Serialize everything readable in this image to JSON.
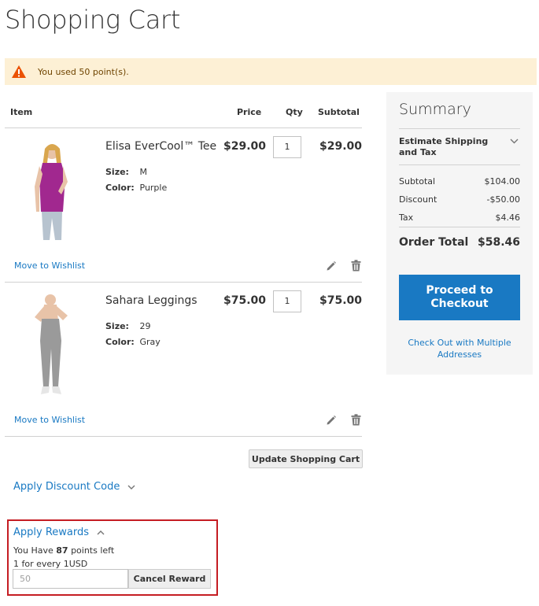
{
  "page": {
    "title": "Shopping Cart"
  },
  "notice": {
    "message": "You used 50 point(s)."
  },
  "cart": {
    "headers": {
      "item": "Item",
      "price": "Price",
      "qty": "Qty",
      "subtotal": "Subtotal"
    },
    "items": [
      {
        "name": "Elisa EverCool™ Tee",
        "options": [
          {
            "label": "Size:",
            "value": "M"
          },
          {
            "label": "Color:",
            "value": "Purple"
          }
        ],
        "price": "$29.00",
        "qty": "1",
        "subtotal": "$29.00",
        "wishlist_label": "Move to Wishlist",
        "image_color": "#a1288f"
      },
      {
        "name": "Sahara Leggings",
        "options": [
          {
            "label": "Size:",
            "value": "29"
          },
          {
            "label": "Color:",
            "value": "Gray"
          }
        ],
        "price": "$75.00",
        "qty": "1",
        "subtotal": "$75.00",
        "wishlist_label": "Move to Wishlist",
        "image_color": "#9a9a9a"
      }
    ],
    "update_label": "Update Shopping Cart"
  },
  "discount": {
    "label": "Apply Discount Code"
  },
  "rewards": {
    "title": "Apply Rewards",
    "have_prefix": "You Have",
    "points": "87",
    "have_suffix": "points left",
    "rate": "1 for every 1USD",
    "input_placeholder": "50",
    "cancel_label": "Cancel Reward"
  },
  "summary": {
    "title": "Summary",
    "estimate_label": "Estimate Shipping and Tax",
    "rows": [
      {
        "label": "Subtotal",
        "value": "$104.00"
      },
      {
        "label": "Discount",
        "value": "-$50.00"
      },
      {
        "label": "Tax",
        "value": "$4.46"
      }
    ],
    "order_total_label": "Order Total",
    "order_total_value": "$58.46",
    "checkout_label": "Proceed to Checkout",
    "multi_label": "Check Out with Multiple Addresses"
  },
  "colors": {
    "accent": "#1979c3",
    "notice_bg": "#fdf0d5",
    "warning": "#eb5202",
    "highlight_border": "#c51d23"
  }
}
